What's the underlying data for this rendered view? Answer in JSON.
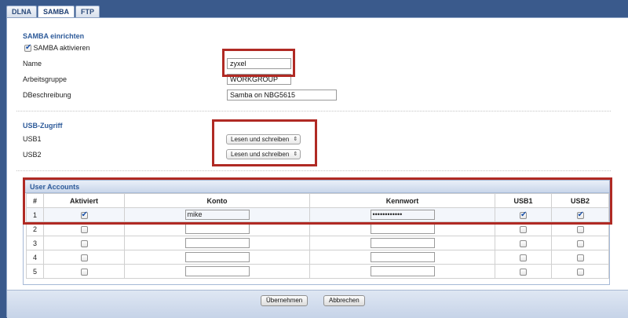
{
  "tabs": [
    {
      "label": "DLNA",
      "active": false
    },
    {
      "label": "SAMBA",
      "active": true
    },
    {
      "label": "FTP",
      "active": false
    }
  ],
  "samba_section": {
    "title": "SAMBA einrichten",
    "enable_label": "SAMBA aktivieren",
    "enable_checked": true,
    "name_label": "Name",
    "name_value": "zyxel",
    "workgroup_label": "Arbeitsgruppe",
    "workgroup_value": "WORKGROUP",
    "description_label": "DBeschreibung",
    "description_value": "Samba on NBG5615"
  },
  "usb_section": {
    "title": "USB-Zugriff",
    "usb1_label": "USB1",
    "usb1_value": "Lesen und schreiben",
    "usb2_label": "USB2",
    "usb2_value": "Lesen und schreiben"
  },
  "accounts": {
    "title": "User Accounts",
    "headers": {
      "num": "#",
      "active": "Aktiviert",
      "account": "Konto",
      "password": "Kennwort",
      "usb1": "USB1",
      "usb2": "USB2"
    },
    "rows": [
      {
        "num": "1",
        "active": true,
        "account": "mike",
        "password": "••••••••••••",
        "usb1": true,
        "usb2": true
      },
      {
        "num": "2",
        "active": false,
        "account": "",
        "password": "",
        "usb1": false,
        "usb2": false
      },
      {
        "num": "3",
        "active": false,
        "account": "",
        "password": "",
        "usb1": false,
        "usb2": false
      },
      {
        "num": "4",
        "active": false,
        "account": "",
        "password": "",
        "usb1": false,
        "usb2": false
      },
      {
        "num": "5",
        "active": false,
        "account": "",
        "password": "",
        "usb1": false,
        "usb2": false
      }
    ]
  },
  "buttons": {
    "apply": "Übernehmen",
    "cancel": "Abbrechen"
  },
  "colors": {
    "highlight": "#b02a24",
    "section_title": "#2d5a99",
    "background": "#3a5a8c"
  }
}
